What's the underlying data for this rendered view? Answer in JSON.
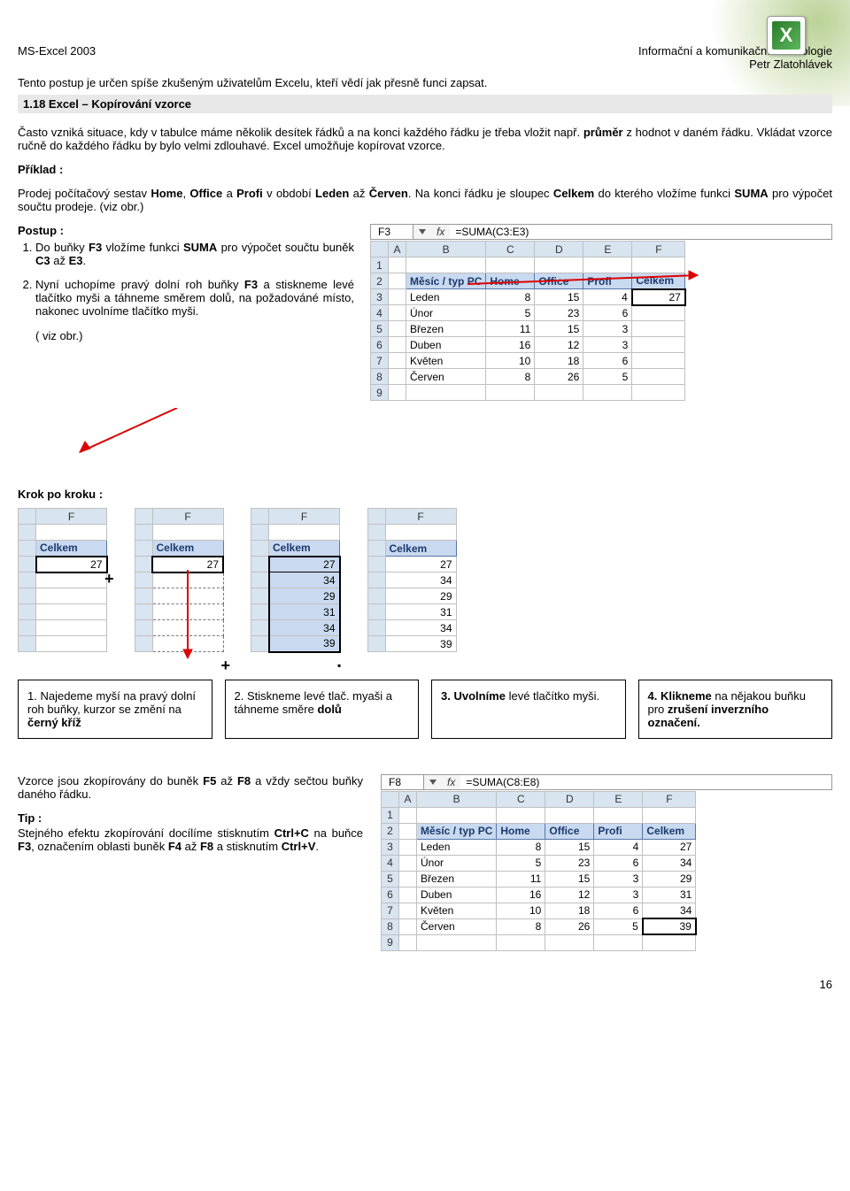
{
  "header": {
    "left": "MS-Excel 2003",
    "right1": "Informační a komunikační technologie",
    "right2": "Petr Zlatohlávek"
  },
  "intro": "Tento postup je určen spíše zkušeným uživatelům Excelu, kteří vědí jak přesně funci zapsat.",
  "section_title": "1.18 Excel – Kopírování vzorce",
  "p1a": "Často vzniká situace, kdy v tabulce máme několik desítek řádků a na konci každého řádku je třeba vložit např. ",
  "p1b": "průměr",
  "p1c": " z hodnot v daném řádku. Vkládat vzorce ručně do každého řádku by bylo velmi zdlouhavé. Excel umožňuje kopírovat vzorce.",
  "priklad_label": "Příklad :",
  "p2a": "Prodej počítačový sestav ",
  "p2b": "Home",
  "p2c": ", ",
  "p2d": "Office",
  "p2e": " a ",
  "p2f": "Profi",
  "p2g": " v období ",
  "p2h": "Leden",
  "p2i": " až ",
  "p2j": "Červen",
  "p2k": ". Na konci řádku je sloupec ",
  "p2l": "Celkem",
  "p2m": " do kterého vložíme funkci ",
  "p2n": "SUMA",
  "p2o": " pro výpočet součtu prodeje. (viz obr.)",
  "postup_label": "Postup :",
  "step1a": "Do buňky ",
  "step1b": "F3",
  "step1c": " vložíme funkci ",
  "step1d": "SUMA",
  "step1e": " pro výpočet součtu buněk ",
  "step1f": "C3",
  "step1g": " až ",
  "step1h": "E3",
  "step1i": ".",
  "step2a": "Nyní uchopíme pravý dolní roh buňky ",
  "step2b": "F3",
  "step2c": " a stiskneme levé tlačítko myši a táhneme směrem dolů, na požadováné místo, nakonec uvolníme tlačítko myši.",
  "viz_obr": "( viz obr.)",
  "fbar1": {
    "name": "F3",
    "fx": "fx",
    "formula": "=SUMA(C3:E3)"
  },
  "table1": {
    "cols": [
      "A",
      "B",
      "C",
      "D",
      "E",
      "F"
    ],
    "hdr": [
      "Měsíc / typ PC",
      "Home",
      "Office",
      "Profi",
      "Celkem"
    ],
    "rows": [
      [
        "Leden",
        "8",
        "15",
        "4",
        "27"
      ],
      [
        "Únor",
        "5",
        "23",
        "6",
        ""
      ],
      [
        "Březen",
        "11",
        "15",
        "3",
        ""
      ],
      [
        "Duben",
        "16",
        "12",
        "3",
        ""
      ],
      [
        "Květen",
        "10",
        "18",
        "6",
        ""
      ],
      [
        "Červen",
        "8",
        "26",
        "5",
        ""
      ]
    ]
  },
  "krok_label": "Krok po kroku :",
  "mini": {
    "col": "F",
    "hdr": "Celkem",
    "vals1": [
      "27",
      "",
      "",
      "",
      "",
      ""
    ],
    "vals2": [
      "27",
      "",
      "",
      "",
      "",
      ""
    ],
    "vals3": [
      "27",
      "34",
      "29",
      "31",
      "34",
      "39"
    ],
    "vals4": [
      "27",
      "34",
      "29",
      "31",
      "34",
      "39"
    ]
  },
  "box1a": "1. Najedeme myší na pravý dolní roh buňky, kurzor se změní na ",
  "box1b": "černý kříž",
  "box2a": "2. Stiskneme levé tlač. myaši a táhneme směre ",
  "box2b": "dolů",
  "box3a": "3. Uvolníme",
  "box3b": " levé tlačítko myši.",
  "box4a": "4. Klikneme",
  "box4b": " na nějakou buňku pro ",
  "box4c": "zrušení inverzního označení.",
  "final_p1a": "Vzorce jsou zkopírovány do buněk ",
  "final_p1b": "F5",
  "final_p1c": " až ",
  "final_p1d": "F8",
  "final_p1e": " a vždy sečtou buňky daného řádku.",
  "tip_label": "Tip :",
  "tip_a": "Stejného efektu zkopírování docílíme stisknutím ",
  "tip_b": "Ctrl+C",
  "tip_c": " na buňce ",
  "tip_d": "F3",
  "tip_e": ", označením oblasti buněk ",
  "tip_f": "F4",
  "tip_g": " až ",
  "tip_h": "F8",
  "tip_i": " a stisknutím ",
  "tip_j": "Ctrl+V",
  "tip_k": ".",
  "fbar2": {
    "name": "F8",
    "fx": "fx",
    "formula": "=SUMA(C8:E8)"
  },
  "table2": {
    "cols": [
      "A",
      "B",
      "C",
      "D",
      "E",
      "F"
    ],
    "hdr": [
      "Měsíc / typ PC",
      "Home",
      "Office",
      "Profi",
      "Celkem"
    ],
    "rows": [
      [
        "Leden",
        "8",
        "15",
        "4",
        "27"
      ],
      [
        "Únor",
        "5",
        "23",
        "6",
        "34"
      ],
      [
        "Březen",
        "11",
        "15",
        "3",
        "29"
      ],
      [
        "Duben",
        "16",
        "12",
        "3",
        "31"
      ],
      [
        "Květen",
        "10",
        "18",
        "6",
        "34"
      ],
      [
        "Červen",
        "8",
        "26",
        "5",
        "39"
      ]
    ]
  },
  "pagenum": "16"
}
